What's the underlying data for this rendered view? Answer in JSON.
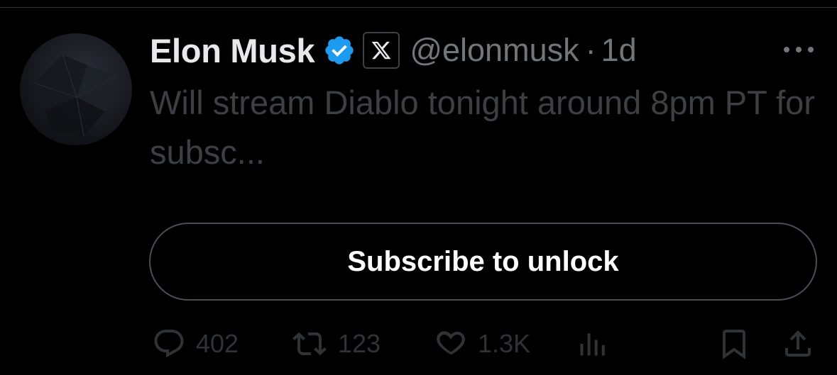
{
  "author": {
    "name": "Elon Musk",
    "handle": "@elonmusk",
    "separator": "·",
    "time": "1d"
  },
  "tweet": {
    "text": "Will stream Diablo tonight around 8pm PT for subsc..."
  },
  "subscribe_button": {
    "label": "Subscribe to unlock"
  },
  "actions": {
    "reply_count": "402",
    "repost_count": "123",
    "like_count": "1.3K"
  },
  "icons": [
    "verified-badge-icon",
    "x-logo-icon",
    "more-icon",
    "reply-icon",
    "repost-icon",
    "like-icon",
    "views-icon",
    "bookmark-icon",
    "share-icon"
  ],
  "colors": {
    "background": "#000000",
    "verified_blue": "#1d9bf0",
    "muted_text": "#71767b",
    "dimmed_text": "#3c3f44",
    "border": "#4a4f55"
  }
}
